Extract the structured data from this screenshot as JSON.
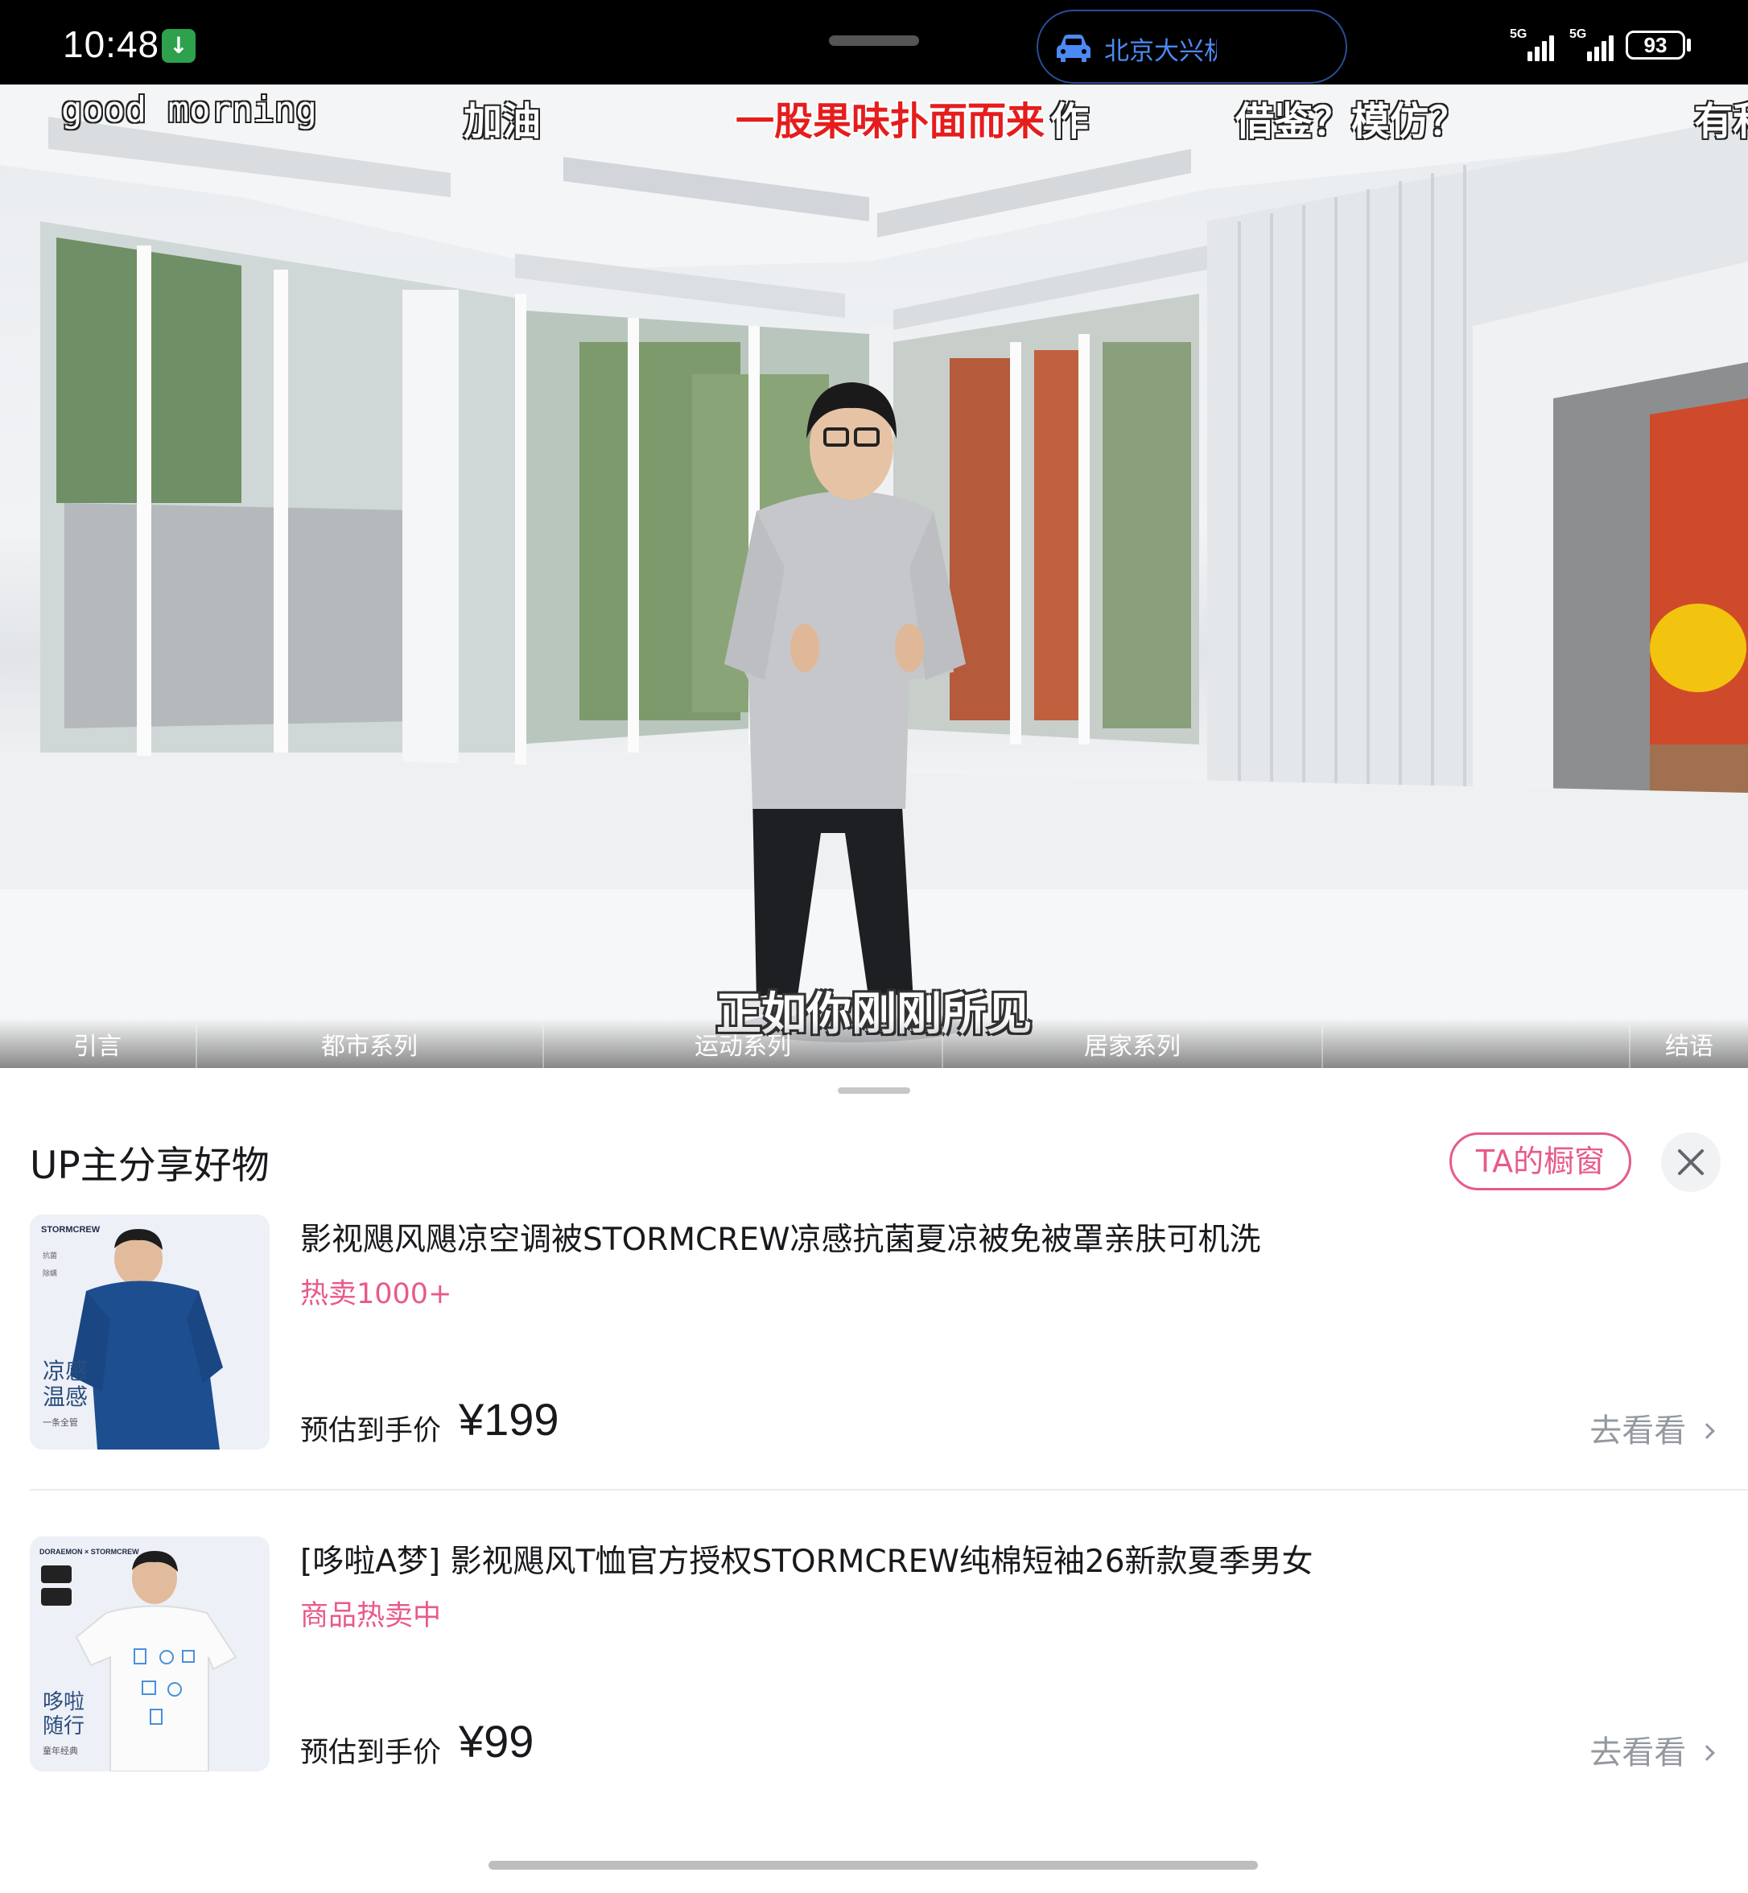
{
  "status_bar": {
    "time": "10:48",
    "app_badge_icon": "green-app-icon",
    "navigation_text": "北京大兴机",
    "signal_1": "5G",
    "signal_2": "5G",
    "battery": "93"
  },
  "video": {
    "danmaku": [
      {
        "text": "good morning",
        "style": "mono"
      },
      {
        "text": "加油",
        "style": "plain"
      },
      {
        "text": "一股果味扑面而来",
        "style": "red"
      },
      {
        "text": "作",
        "style": "plain"
      },
      {
        "text": "借鉴？模仿？",
        "style": "plain"
      },
      {
        "text": "有和",
        "style": "plain"
      }
    ],
    "subtitle": "正如你刚刚所见",
    "chapters": [
      "引言",
      "都市系列",
      "运动系列",
      "居家系列",
      "结语"
    ]
  },
  "sheet": {
    "title": "UP主分享好物",
    "shop_button": "TA的橱窗",
    "close_icon": "close-icon",
    "products": [
      {
        "title": "影视飓风飓凉空调被STORMCREW凉感抗菌夏凉被免被罩亲肤可机洗",
        "badge": "热卖1000+",
        "price_label": "预估到手价",
        "price": "¥199",
        "go": "去看看",
        "thumb": {
          "brand": "STORMCREW",
          "tag_1": "抗菌",
          "tag_2": "除螨",
          "headline_1": "凉感",
          "headline_2": "温感",
          "caption": "一条全管",
          "accent": "#1d4e8f"
        }
      },
      {
        "title": "[哆啦A梦] 影视飓风T恤官方授权STORMCREW纯棉短袖26新款夏季男女",
        "badge": "商品热卖中",
        "price_label": "预估到手价",
        "price": "¥99",
        "go": "去看看",
        "thumb": {
          "brand": "DORAEMON × STORMCREW",
          "headline_1": "哆啦",
          "headline_2": "随行",
          "caption": "童年经典",
          "accent": "#ffffff"
        }
      }
    ]
  },
  "colors": {
    "accent_pink": "#e85a8b",
    "nav_blue": "#4b8af2"
  }
}
